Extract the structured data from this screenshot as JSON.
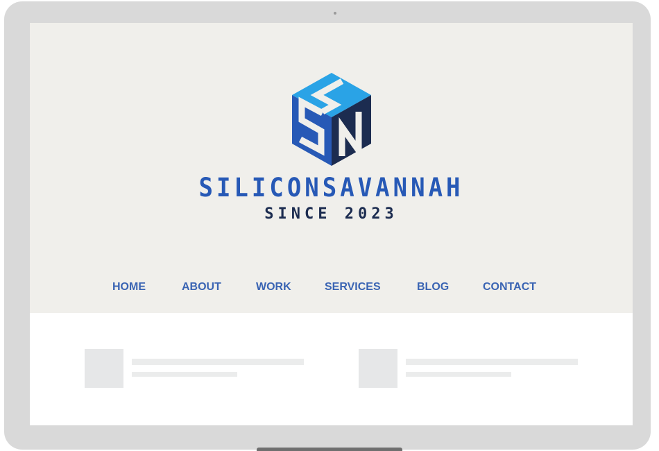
{
  "brand": {
    "name": "SILICONSAVANNAH",
    "tagline": "SINCE 2023",
    "logo_icon": "ss-cube-logo",
    "colors": {
      "primary_blue": "#2759b6",
      "light_blue": "#2aa3e6",
      "navy": "#1c2c50",
      "hero_background": "#f0efeb"
    }
  },
  "nav": {
    "items": [
      {
        "label": "HOME"
      },
      {
        "label": "ABOUT"
      },
      {
        "label": "WORK"
      },
      {
        "label": "SERVICES"
      },
      {
        "label": "BLOG"
      },
      {
        "label": "CONTACT"
      }
    ]
  },
  "content": {
    "placeholder_cards": 2
  }
}
